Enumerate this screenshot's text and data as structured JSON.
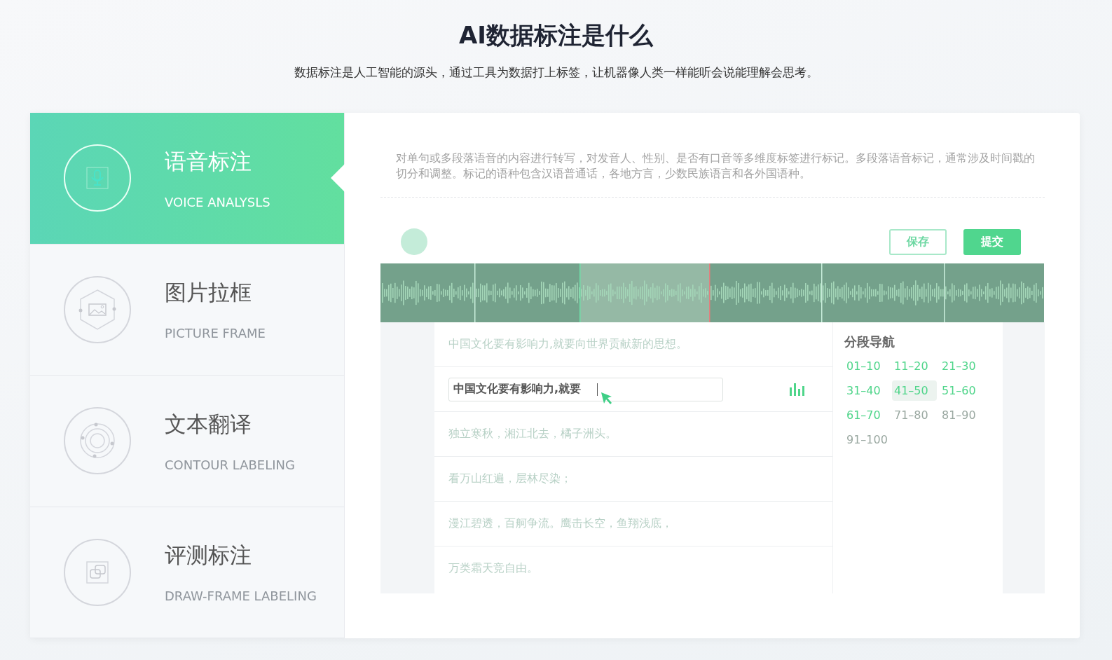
{
  "heading": {
    "title": "AI数据标注是什么",
    "subtitle": "数据标注是人工智能的源头，通过工具为数据打上标签，让机器像人类一样能听会说能理解会思考。"
  },
  "tabs": [
    {
      "kind": "voice",
      "title": "语音标注",
      "subtitle": "VOICE ANALYSLS",
      "selected": true
    },
    {
      "kind": "picture",
      "title": "图片拉框",
      "subtitle": "PICTURE FRAME",
      "selected": false
    },
    {
      "kind": "orbit",
      "title": "文本翻译",
      "subtitle": "CONTOUR LABELING",
      "selected": false
    },
    {
      "kind": "layers",
      "title": "评测标注",
      "subtitle": "DRAW-FRAME LABELING",
      "selected": false
    }
  ],
  "description": "对单句或多段落语音的内容进行转写，对发音人、性别、是否有口音等多维度标签进行标记。多段落语音标记，通常涉及时间戳的切分和调整。标记的语种包含汉语普通话，各地方言，少数民族语言和各外国语种。",
  "toolbar": {
    "buttons": [
      {
        "label": "保存",
        "kind": "outline"
      },
      {
        "label": "提交",
        "kind": "primary"
      }
    ]
  },
  "waveform": {
    "segments": [
      {
        "selected": false
      },
      {
        "selected": false
      },
      {
        "selected": true
      },
      {
        "selected": false
      },
      {
        "selected": false
      },
      {
        "selected": false
      }
    ]
  },
  "sentences": [
    {
      "kind": "text",
      "text": "中国文化要有影响力,就要向世界贡献新的思想。"
    },
    {
      "kind": "editing",
      "value": "中国文化要有影响力,就要"
    },
    {
      "kind": "text",
      "text": "独立寒秋，湘江北去，橘子洲头。"
    },
    {
      "kind": "text",
      "text": "看万山红遍，层林尽染；"
    },
    {
      "kind": "text",
      "text": "漫江碧透，百舸争流。鹰击长空，鱼翔浅底，"
    },
    {
      "kind": "text",
      "text": "万类霜天竞自由。"
    }
  ],
  "segment_nav": {
    "title": "分段导航",
    "items": [
      {
        "label": "01–10",
        "done": true,
        "selected": false
      },
      {
        "label": "11–20",
        "done": true,
        "selected": false
      },
      {
        "label": "21–30",
        "done": true,
        "selected": false
      },
      {
        "label": "31–40",
        "done": true,
        "selected": false
      },
      {
        "label": "41–50",
        "done": true,
        "selected": true
      },
      {
        "label": "51–60",
        "done": true,
        "selected": false
      },
      {
        "label": "61–70",
        "done": true,
        "selected": false
      },
      {
        "label": "71–80",
        "done": false,
        "selected": false
      },
      {
        "label": "81–90",
        "done": false,
        "selected": false
      },
      {
        "label": "91–100",
        "done": false,
        "selected": false
      }
    ]
  }
}
